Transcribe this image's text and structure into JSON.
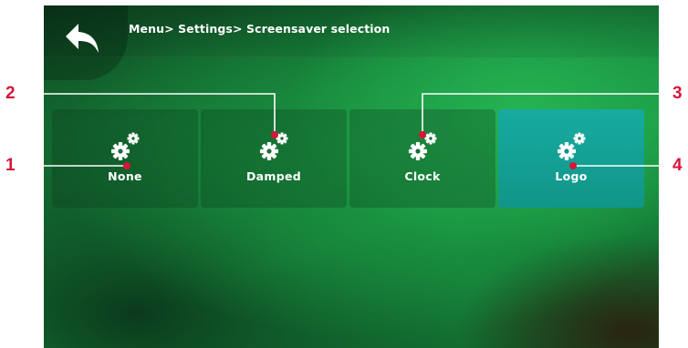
{
  "header": {
    "breadcrumb": "Menu> Settings> Screensaver selection"
  },
  "tiles": [
    {
      "label": "None",
      "selected": false
    },
    {
      "label": "Damped",
      "selected": false
    },
    {
      "label": "Clock",
      "selected": false
    },
    {
      "label": "Logo",
      "selected": true
    }
  ],
  "callouts": [
    "1",
    "2",
    "3",
    "4"
  ],
  "colors": {
    "callout": "#d6163a",
    "selected_tile": "#15a59b",
    "background": "#1b9a45"
  }
}
